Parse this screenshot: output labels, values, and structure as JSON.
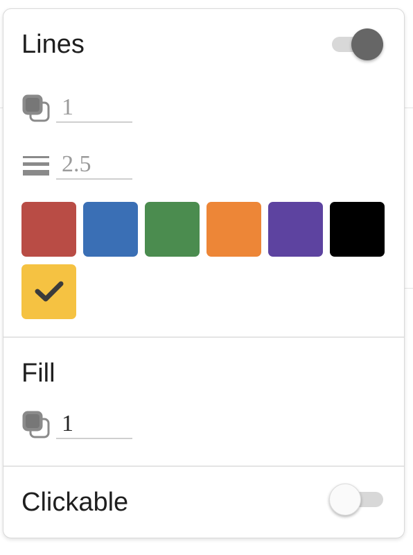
{
  "lines": {
    "title": "Lines",
    "toggle_on": true,
    "opacity_value": "1",
    "thickness_value": "2.5",
    "colors": [
      {
        "name": "red",
        "hex": "#b94c45"
      },
      {
        "name": "blue",
        "hex": "#3a6fb5"
      },
      {
        "name": "green",
        "hex": "#4b8c4f"
      },
      {
        "name": "orange",
        "hex": "#ed8637"
      },
      {
        "name": "purple",
        "hex": "#5d43a0"
      },
      {
        "name": "black",
        "hex": "#000000"
      },
      {
        "name": "yellow",
        "hex": "#f5c242",
        "selected": true
      }
    ]
  },
  "fill": {
    "title": "Fill",
    "opacity_value": "1"
  },
  "clickable": {
    "title": "Clickable",
    "toggle_on": false
  },
  "icons": {
    "opacity": "layers-opacity-icon",
    "thickness": "line-weight-icon",
    "selected": "checkmark-icon"
  }
}
